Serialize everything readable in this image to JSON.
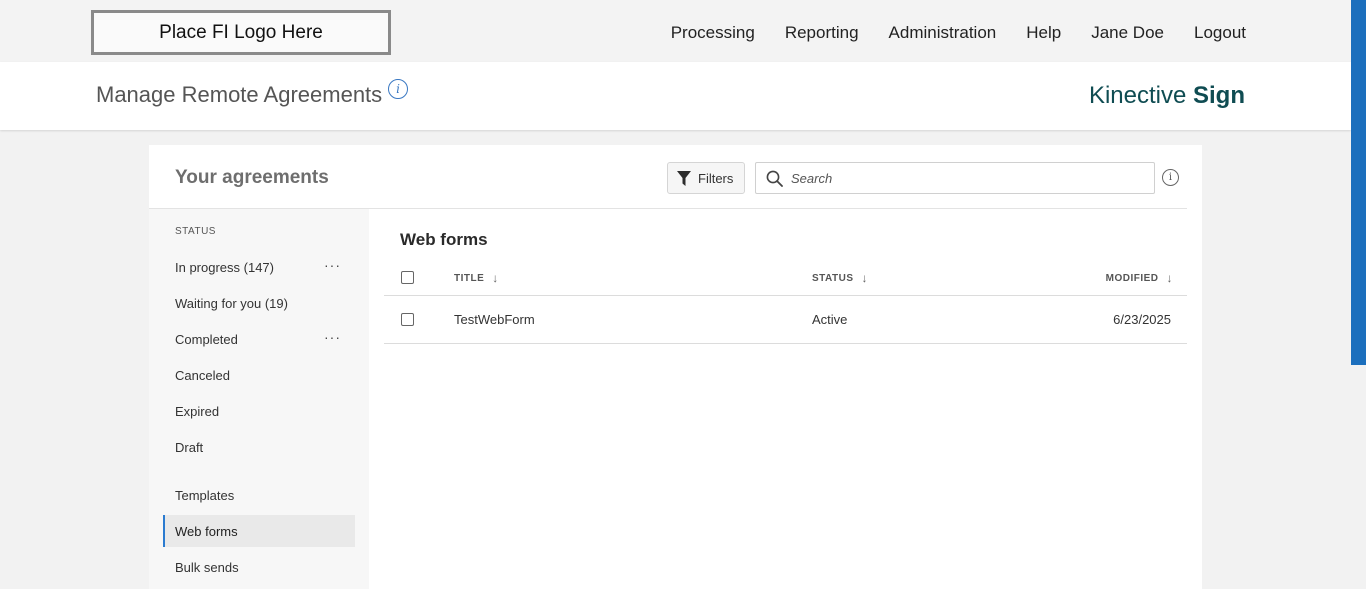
{
  "topbar": {
    "logo_text": "Place FI Logo Here",
    "nav": [
      "Processing",
      "Reporting",
      "Administration",
      "Help",
      "Jane Doe",
      "Logout"
    ]
  },
  "header": {
    "title": "Manage Remote Agreements",
    "info_glyph": "i",
    "brand_light": "Kinective ",
    "brand_bold": "Sign"
  },
  "card": {
    "title": "Your agreements",
    "filters_label": "Filters",
    "search_placeholder": "Search"
  },
  "sidebar": {
    "section_label": "STATUS",
    "status_items": [
      {
        "label": "In progress (147)",
        "has_menu": true
      },
      {
        "label": "Waiting for you (19)",
        "has_menu": false
      },
      {
        "label": "Completed",
        "has_menu": true
      },
      {
        "label": "Canceled",
        "has_menu": false
      },
      {
        "label": "Expired",
        "has_menu": false
      },
      {
        "label": "Draft",
        "has_menu": false
      }
    ],
    "other_items": [
      {
        "label": "Templates",
        "active": false
      },
      {
        "label": "Web forms",
        "active": true
      },
      {
        "label": "Bulk sends",
        "active": false
      }
    ],
    "menu_glyph": "···"
  },
  "content": {
    "section_title": "Web forms",
    "columns": [
      "TITLE",
      "STATUS",
      "MODIFIED"
    ],
    "sort_glyph": "↓",
    "rows": [
      {
        "title": "TestWebForm",
        "status": "Active",
        "modified": "6/23/2025"
      }
    ]
  },
  "colors": {
    "brand": "#0f4c52",
    "accent": "#2b7bd0",
    "scrollbar": "#1c6fbd"
  },
  "icons": [
    "info-icon",
    "filter-icon",
    "search-icon",
    "more-icon",
    "sort-down-icon",
    "checkbox-icon"
  ]
}
